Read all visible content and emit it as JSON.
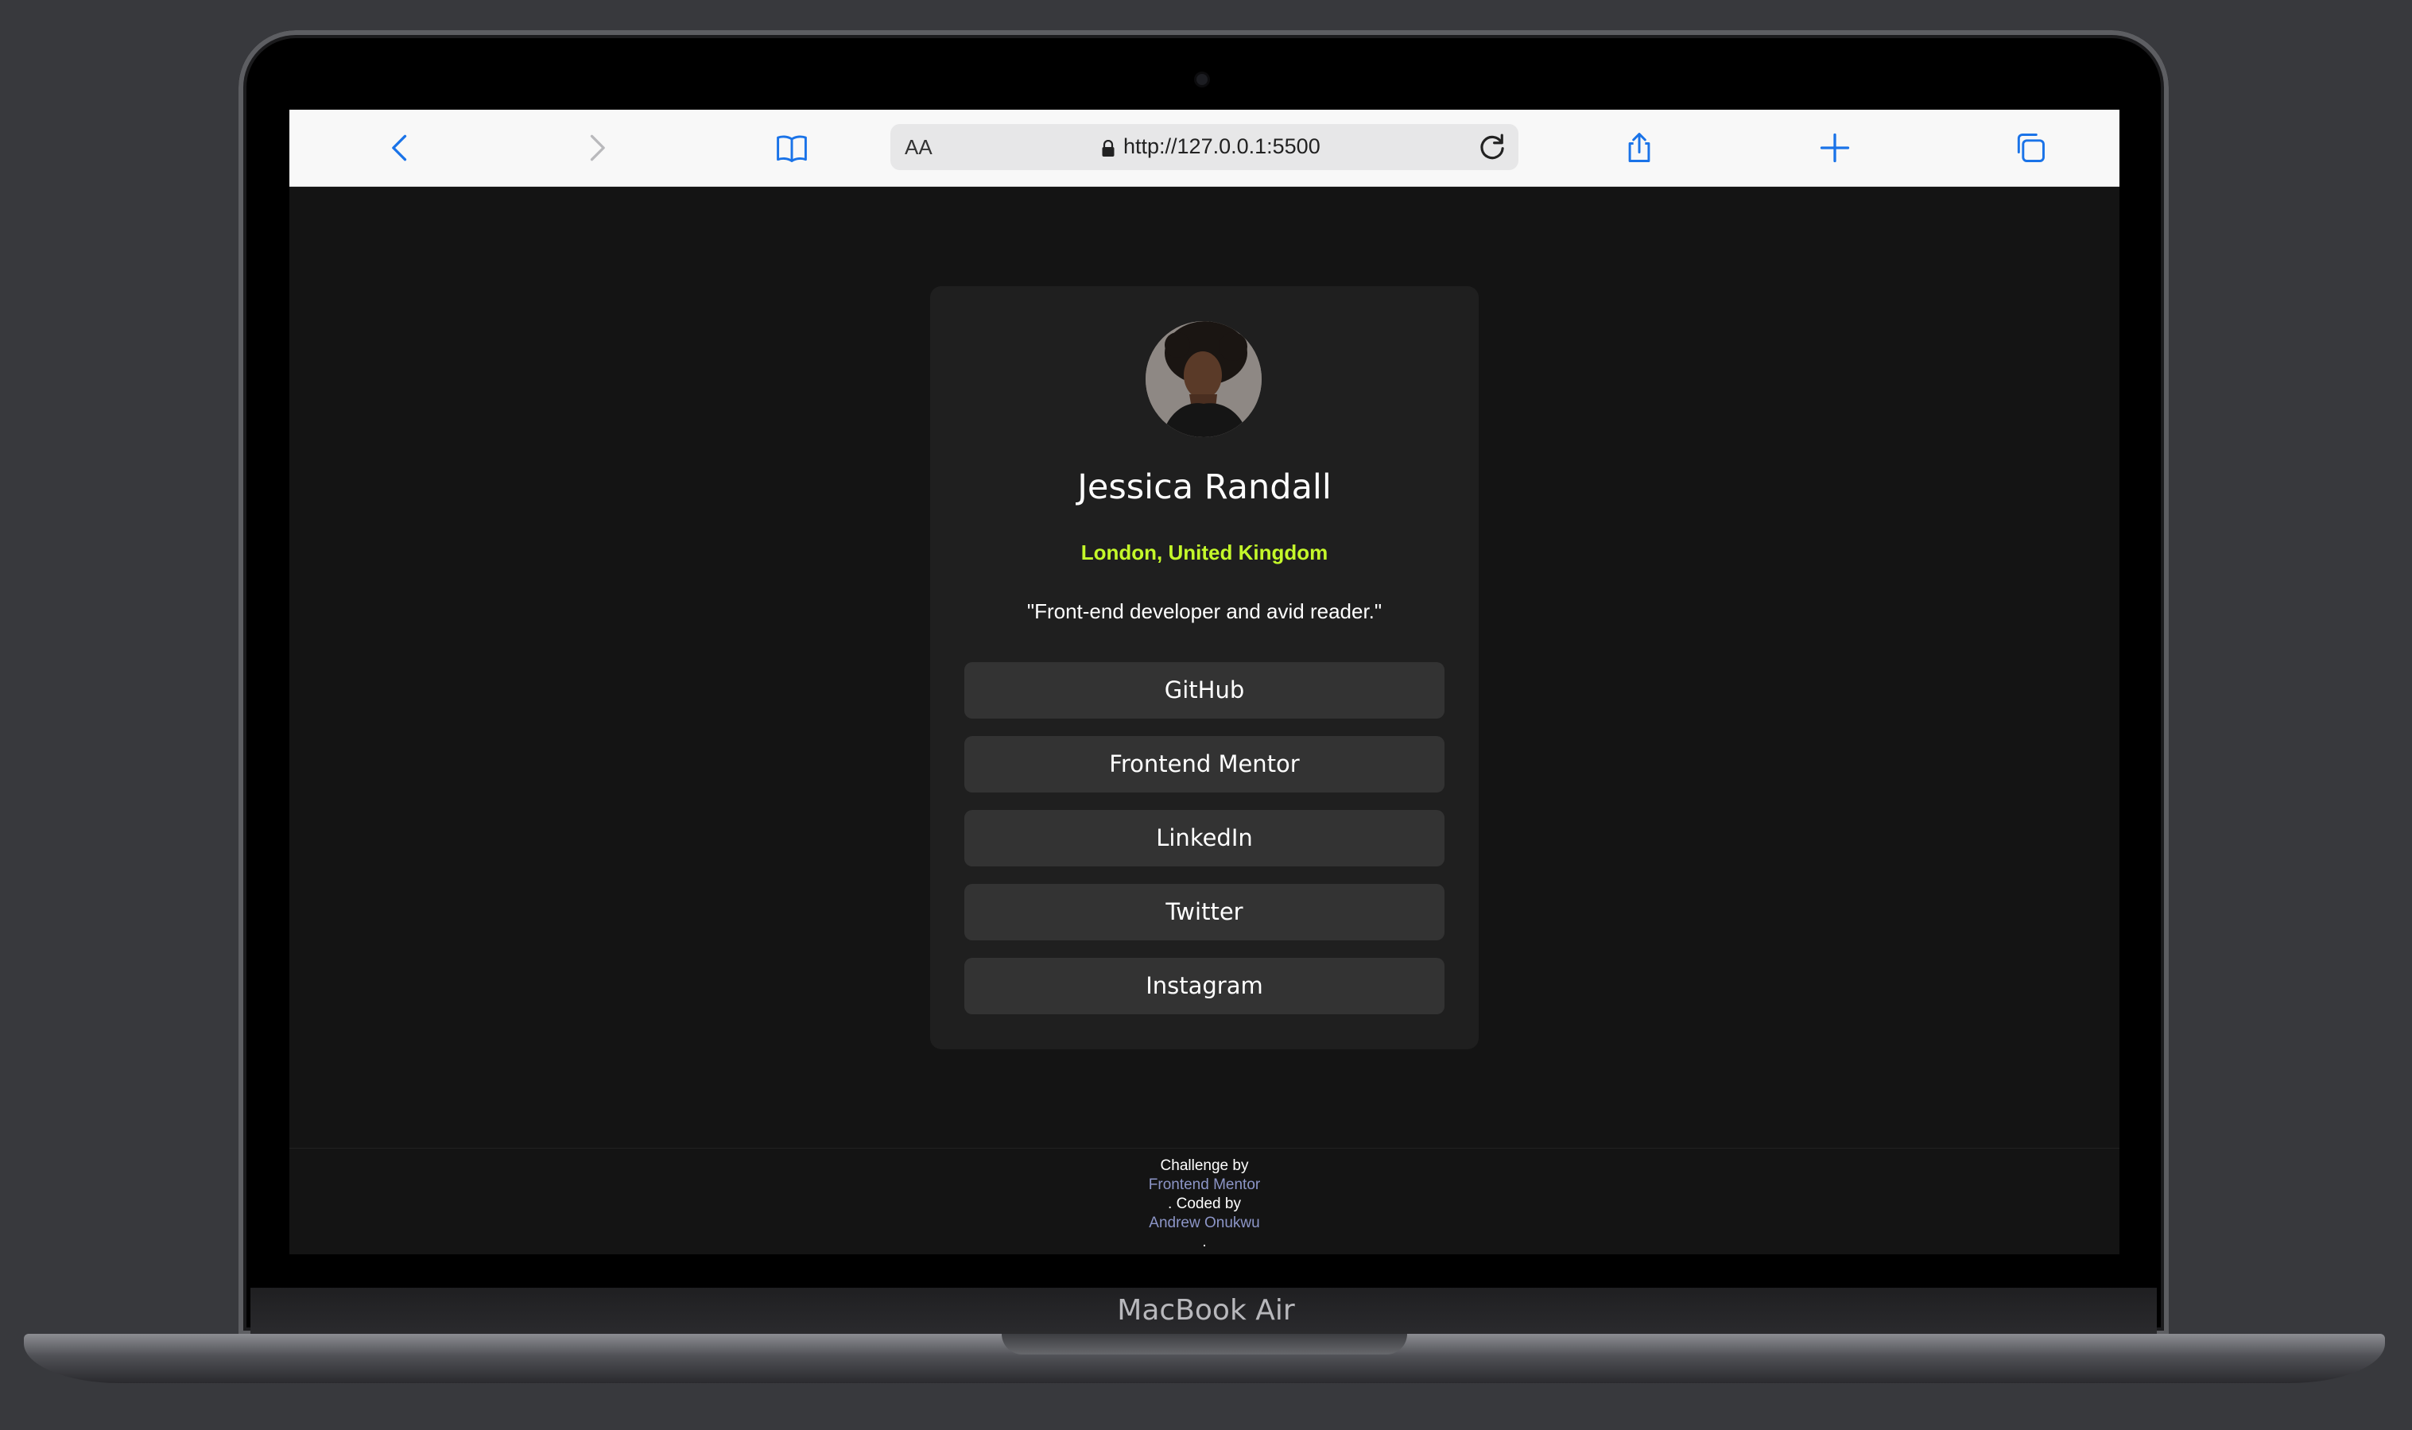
{
  "device": {
    "brand_label": "MacBook Air"
  },
  "browser": {
    "aa_label": "AA",
    "url": "http://127.0.0.1:5500",
    "icons": [
      "back-icon",
      "forward-icon",
      "bookmarks-icon",
      "lock-icon",
      "reload-icon",
      "share-icon",
      "new-tab-icon",
      "tabs-icon"
    ],
    "accent_color": "#1a73e8"
  },
  "profile": {
    "name": "Jessica Randall",
    "location": "London, United Kingdom",
    "bio": "\"Front-end developer and avid reader.\"",
    "accent_color": "#c4f82a",
    "links": [
      {
        "label": "GitHub"
      },
      {
        "label": "Frontend Mentor"
      },
      {
        "label": "LinkedIn"
      },
      {
        "label": "Twitter"
      },
      {
        "label": "Instagram"
      }
    ]
  },
  "footer": {
    "challenge_by": "Challenge by",
    "challenge_link": "Frontend Mentor",
    "coded_by": ". Coded by",
    "author_link": "Andrew Onukwu",
    "end": "."
  }
}
